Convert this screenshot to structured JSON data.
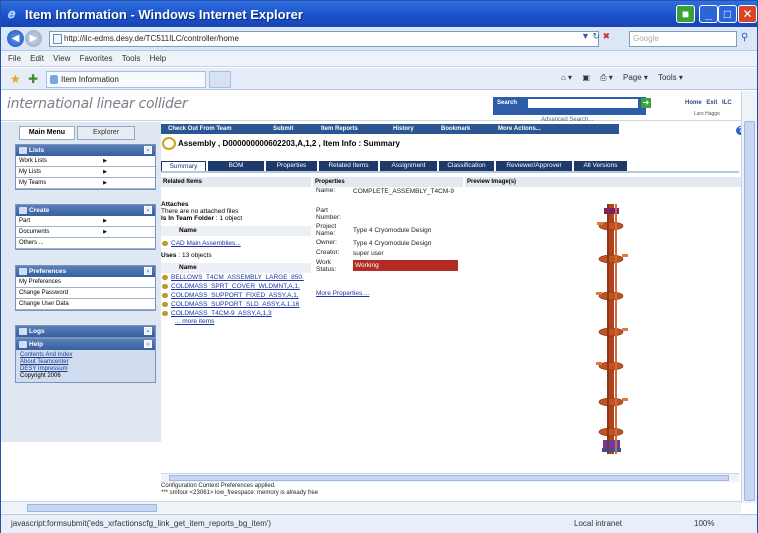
{
  "window": {
    "title": "Item Information - Windows Internet Explorer"
  },
  "browser": {
    "url": "http://ilc-edms.desy.de/TC511ILC/controller/home",
    "search_placeholder": "Google",
    "menu": [
      "File",
      "Edit",
      "View",
      "Favorites",
      "Tools",
      "Help"
    ],
    "tab_label": "Item Information",
    "commands": [
      "Page ▾",
      "Tools ▾"
    ],
    "status_text": "javascript:formsubmit('eds_xrfactionscfg_link_get_item_reports_bg_item')",
    "zone": "Local intranet",
    "zoom": "100%"
  },
  "header": {
    "logo": "international linear collider",
    "search_label": "Search",
    "advanced_search": "Advanced Search...",
    "links": [
      "Home",
      "Exit",
      "ILC"
    ],
    "user": "Lars Hagge"
  },
  "left": {
    "tabs": [
      "Main Menu",
      "Explorer"
    ],
    "lists": {
      "title": "Lists",
      "items": [
        "Work Lists",
        "My Lists",
        "My Teams"
      ]
    },
    "create": {
      "title": "Create",
      "items": [
        "Part",
        "Documents",
        "Others ..."
      ]
    },
    "preferences": {
      "title": "Preferences",
      "items": [
        "My Preferences",
        "Change Password",
        "Change User Data"
      ]
    },
    "logs": {
      "title": "Logs"
    },
    "help": {
      "title": "Help",
      "links": [
        "Contents And Index",
        "About Teamcenter",
        "DESY Impressum"
      ],
      "copyright": "Copyright 2006"
    }
  },
  "nav": [
    "Check Out From Team",
    "Submit",
    "Item Reports",
    "History",
    "Bookmark",
    "More Actions..."
  ],
  "item": {
    "heading": "Assembly , D000000000602203,A,1,2 , Item Info : Summary",
    "tabs": [
      "Summary",
      "BOM",
      "Properties",
      "Related Items",
      "Assignment",
      "Classification",
      "Reviewer/Approver",
      "All Versions"
    ]
  },
  "related": {
    "title": "Related Items",
    "attaches_title": "Attaches",
    "attaches_text": "There are no attached files",
    "team_folder": "Is In Team Folder",
    "team_folder_count": ": 1 object",
    "name_col": "Name",
    "folder_link": "CAD Main Assemblies...",
    "uses": "Uses",
    "uses_count": ": 13 objects",
    "uses_items": [
      "BELLOWS_T4CM_ASSEMBLY_LARGE_850.",
      "COLDMASS_SPRT_COVER_WLDMNT,A,1,",
      "COLDMASS_SUPPORT_FIXED_ASSY,A,1,",
      "COLDMASS_SUPPORT_SLD_ASSY,A,1,16",
      "COLDMASS_T4CM-9_ASSY,A,1,3"
    ],
    "more_items": "... more items"
  },
  "properties": {
    "title": "Properties",
    "rows": [
      {
        "label": "Name:",
        "value": "COMPLETE_ASSEMBLY_T4CM-9"
      },
      {
        "label": "Part Number:",
        "value": ""
      },
      {
        "label": "Project Name:",
        "value": "Type 4 Cryomodule Design"
      },
      {
        "label": "Owner:",
        "value": "Type 4 Cryomodule Design"
      },
      {
        "label": "Creator:",
        "value": "super user"
      },
      {
        "label": "Work Status:",
        "value": "Working"
      }
    ],
    "more": "More Properties ..."
  },
  "preview": {
    "title": "Preview Image(s)"
  },
  "messages": [
    "Configuration Context Preferences applied.",
    "*** smfour <23061> low_freespace: memory is already free"
  ],
  "colors": {
    "nav_blue": "#2c5593",
    "working_red": "#b42b23",
    "brand_blue": "#2b5da8"
  }
}
